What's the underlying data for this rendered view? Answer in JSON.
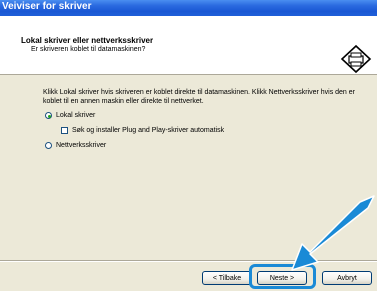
{
  "window": {
    "title": "Veiviser for skriver"
  },
  "header": {
    "title": "Lokal skriver eller nettverksskriver",
    "subtitle": "Er skriveren koblet til datamaskinen?",
    "icon": "printer-wizard-icon"
  },
  "body": {
    "intro": "Klikk Lokal skriver hvis skriveren er koblet direkte til datamaskinen. Klikk Nettverksskriver hvis den er koblet til en annen maskin eller direkte til nettverket.",
    "options": {
      "local": {
        "label": "Lokal skriver",
        "checked": true
      },
      "plug_and_play": {
        "label": "Søk og installer Plug and Play-skriver automatisk",
        "checked": false
      },
      "network": {
        "label": "Nettverksskriver",
        "checked": false
      }
    }
  },
  "buttons": {
    "back": "< Tilbake",
    "next": "Neste >",
    "cancel": "Avbryt"
  },
  "colors": {
    "titlebar": "#1f5fd8",
    "annotation": "#1a8ad6",
    "dialog_bg": "#ece9d8"
  }
}
